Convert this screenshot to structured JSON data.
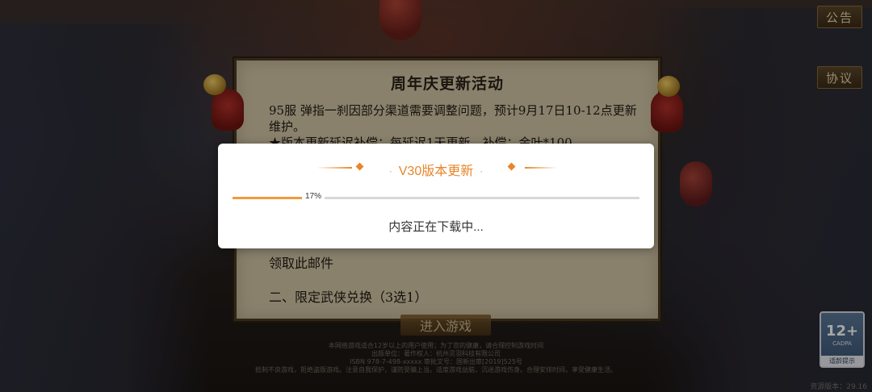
{
  "top_buttons": {
    "notice": "公告",
    "agreement": "协议"
  },
  "notice_panel": {
    "title": "周年庆更新活动",
    "paragraphs": [
      "95服 弹指一刹因部分渠道需要调整问题，预计9月17日10-12点更新维护。",
      "★版本更新延迟补偿：每延迟1天更新，补偿：金叶*100"
    ],
    "lower_lines": [
      "领取此邮件",
      "二、限定武侠兑换（3选1）"
    ]
  },
  "enter_button": "进入游戏",
  "footer_lines": [
    "本网络游戏适合12岁以上的用户使用；为了您的健康，请合理控制游戏时间",
    "出版单位：著作权人：杭州灵羽科技有限公司",
    "ISBN 978-7-498-xxxxx 审批文号：国新出审[2019]525号",
    "抵制不良游戏，拒绝盗版游戏。注意自我保护，谨防受骗上当。适度游戏益脑，沉迷游戏伤身。合理安排时间，享受健康生活。"
  ],
  "age_rating": {
    "age": "12+",
    "org": "CADPA",
    "tip": "适龄提示"
  },
  "version_corner": "资源版本：29.16",
  "dialog": {
    "title": "V30版本更新",
    "progress_percent": 17,
    "progress_label": "17%",
    "status": "内容正在下载中..."
  },
  "colors": {
    "accent": "#e8862a",
    "progress_fill": "#f19a3e",
    "progress_track": "#d8d8d8"
  }
}
